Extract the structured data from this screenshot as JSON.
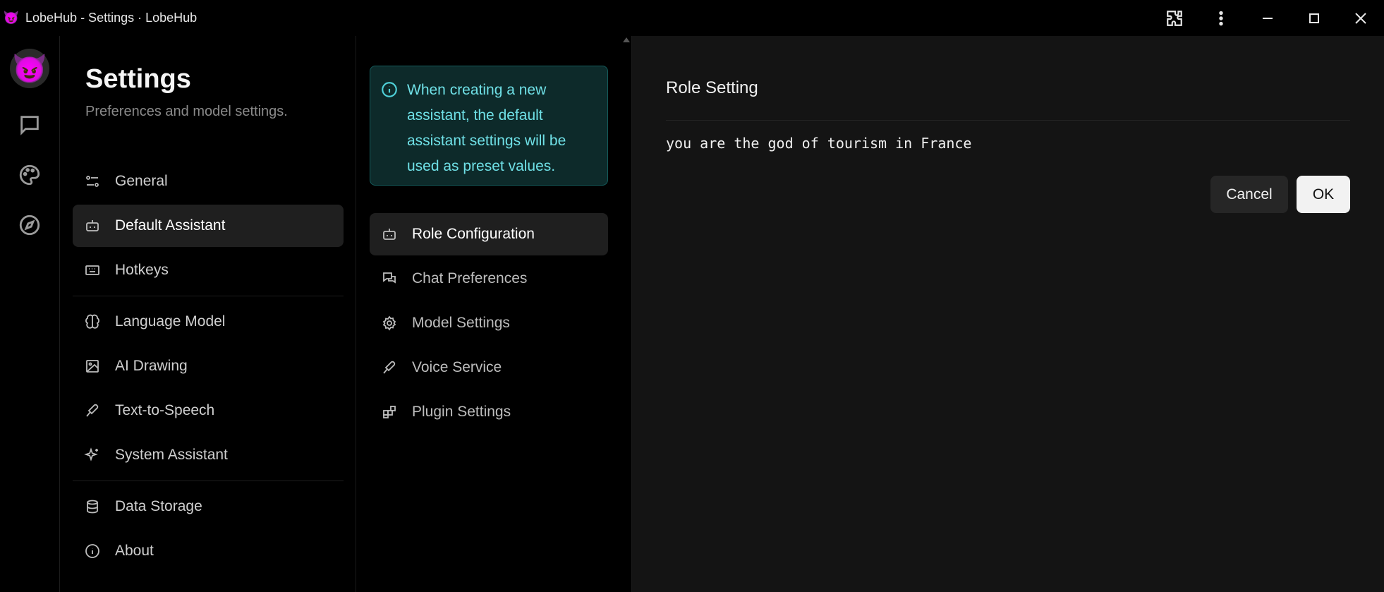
{
  "window": {
    "title": "LobeHub - Settings · LobeHub",
    "logo": "lobehub-logo-icon"
  },
  "titlebar_icons": [
    "extension-icon",
    "more-vertical-icon",
    "minimize-icon",
    "maximize-icon",
    "close-icon"
  ],
  "rail": {
    "avatar": "😈",
    "items": [
      "chat-icon",
      "palette-icon",
      "compass-icon"
    ]
  },
  "settings": {
    "title": "Settings",
    "subtitle": "Preferences and model settings.",
    "items": [
      {
        "label": "General",
        "icon": "sliders-icon"
      },
      {
        "label": "Default Assistant",
        "icon": "bot-icon",
        "active": true
      },
      {
        "label": "Hotkeys",
        "icon": "keyboard-icon"
      },
      {
        "label": "Language Model",
        "icon": "brain-icon"
      },
      {
        "label": "AI Drawing",
        "icon": "image-icon"
      },
      {
        "label": "Text-to-Speech",
        "icon": "mic-icon"
      },
      {
        "label": "System Assistant",
        "icon": "sparkles-icon"
      },
      {
        "label": "Data Storage",
        "icon": "database-icon"
      },
      {
        "label": "About",
        "icon": "info-icon"
      }
    ]
  },
  "subnav": {
    "info": "When creating a new assistant, the default assistant settings will be used as preset values.",
    "items": [
      {
        "label": "Role Configuration",
        "icon": "bot-icon",
        "active": true
      },
      {
        "label": "Chat Preferences",
        "icon": "chat-bubbles-icon"
      },
      {
        "label": "Model Settings",
        "icon": "gear-icon"
      },
      {
        "label": "Voice Service",
        "icon": "mic-icon"
      },
      {
        "label": "Plugin Settings",
        "icon": "blocks-icon"
      }
    ]
  },
  "main": {
    "title": "Role Setting",
    "prompt_value": "you are the god of tourism in France",
    "cancel_label": "Cancel",
    "ok_label": "OK"
  },
  "colors": {
    "background": "#000000",
    "panel": "#141414",
    "accent": "#6fe0e6",
    "info_bg": "#0d2a2a"
  }
}
